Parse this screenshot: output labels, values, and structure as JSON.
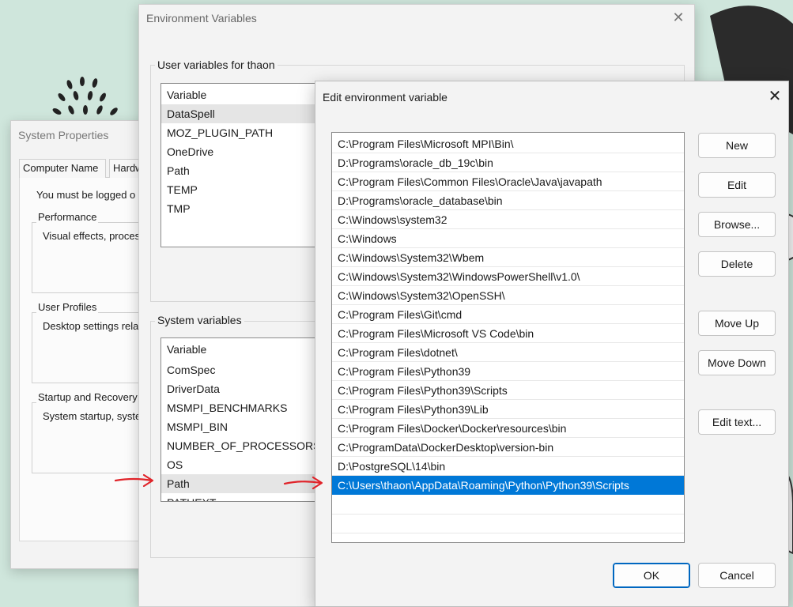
{
  "system_properties": {
    "title": "System Properties",
    "tabs": [
      "Computer Name",
      "Hardw"
    ],
    "note": "You must be logged o",
    "groups": [
      {
        "label": "Performance",
        "desc": "Visual effects, proces"
      },
      {
        "label": "User Profiles",
        "desc": "Desktop settings rela"
      },
      {
        "label": "Startup and Recovery",
        "desc": "System startup, syste"
      }
    ]
  },
  "env_window": {
    "title": "Environment Variables",
    "close_symbol": "✕",
    "user_vars": {
      "label": "User variables for thaon",
      "header": "Variable",
      "items": [
        "DataSpell",
        "MOZ_PLUGIN_PATH",
        "OneDrive",
        "Path",
        "TEMP",
        "TMP"
      ]
    },
    "system_vars": {
      "label": "System variables",
      "header": "Variable",
      "items": [
        "ComSpec",
        "DriverData",
        "MSMPI_BENCHMARKS",
        "MSMPI_BIN",
        "NUMBER_OF_PROCESSORS",
        "OS",
        "Path",
        "PATHEXT"
      ]
    }
  },
  "edit_dialog": {
    "title": "Edit environment variable",
    "close_symbol": "✕",
    "paths": [
      "C:\\Program Files\\Microsoft MPI\\Bin\\",
      "D:\\Programs\\oracle_db_19c\\bin",
      "C:\\Program Files\\Common Files\\Oracle\\Java\\javapath",
      "D:\\Programs\\oracle_database\\bin",
      "C:\\Windows\\system32",
      "C:\\Windows",
      "C:\\Windows\\System32\\Wbem",
      "C:\\Windows\\System32\\WindowsPowerShell\\v1.0\\",
      "C:\\Windows\\System32\\OpenSSH\\",
      "C:\\Program Files\\Git\\cmd",
      "C:\\Program Files\\Microsoft VS Code\\bin",
      "C:\\Program Files\\dotnet\\",
      "C:\\Program Files\\Python39",
      "C:\\Program Files\\Python39\\Scripts",
      "C:\\Program Files\\Python39\\Lib",
      "C:\\Program Files\\Docker\\Docker\\resources\\bin",
      "C:\\ProgramData\\DockerDesktop\\version-bin",
      "D:\\PostgreSQL\\14\\bin",
      "C:\\Users\\thaon\\AppData\\Roaming\\Python\\Python39\\Scripts"
    ],
    "buttons": {
      "new": "New",
      "edit": "Edit",
      "browse": "Browse...",
      "delete": "Delete",
      "move_up": "Move Up",
      "move_down": "Move Down",
      "edit_text": "Edit text...",
      "ok": "OK",
      "cancel": "Cancel"
    }
  },
  "colors": {
    "selection": "#0078d7",
    "annotation_arrow": "#e0242a"
  }
}
